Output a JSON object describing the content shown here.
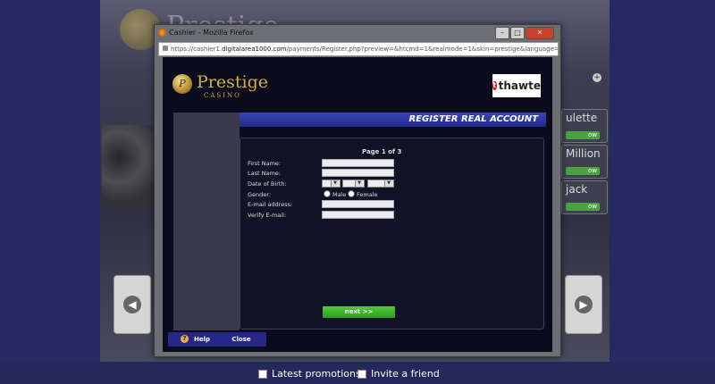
{
  "background": {
    "brand": "Prestige",
    "side_games": [
      {
        "label": "ulette",
        "button": "ow"
      },
      {
        "label": "Million",
        "button": "ow"
      },
      {
        "label": "jack",
        "button": "ow"
      }
    ],
    "nav_prev": "◀",
    "nav_next": "▶",
    "add": "+",
    "bottom_options": [
      {
        "label": "Latest promotions"
      },
      {
        "label": "Invite a friend"
      }
    ]
  },
  "window": {
    "title": "Cashier - Mozilla Firefox",
    "controls": {
      "minimize": "–",
      "maximize": "□",
      "close": "✕"
    },
    "url_prefix": "https://cashier1.",
    "url_domain": "digitalarea1000.com",
    "url_rest": "/payments/Register.php?preview=&htcmd=1&realmode=1&skin=prestige&language=EN&clienttype="
  },
  "cashier": {
    "logo_mark": "P",
    "logo_name": "Prestige",
    "logo_sub": "CASINO",
    "badge_letter": "t",
    "badge": "thawte",
    "header": "REGISTER REAL ACCOUNT",
    "page_label": "Page 1 of 3",
    "fields": {
      "first_name": {
        "label": "First Name:",
        "value": ""
      },
      "last_name": {
        "label": "Last Name:",
        "value": ""
      },
      "dob": {
        "label": "Date of Birth:",
        "day": "",
        "month": "",
        "year": "",
        "dd": "▼"
      },
      "gender": {
        "label": "Gender:",
        "male": "Male",
        "female": "Female"
      },
      "email": {
        "label": "E-mail address:",
        "value": ""
      },
      "verify_email": {
        "label": "Verify E-mail:",
        "value": ""
      }
    },
    "next": "next >>",
    "help": "Help",
    "help_icon": "?",
    "close": "Close"
  },
  "colors": {
    "accent": "#1f2a8a",
    "next": "#3bb52d",
    "brand_gold": "#d3b04a"
  }
}
